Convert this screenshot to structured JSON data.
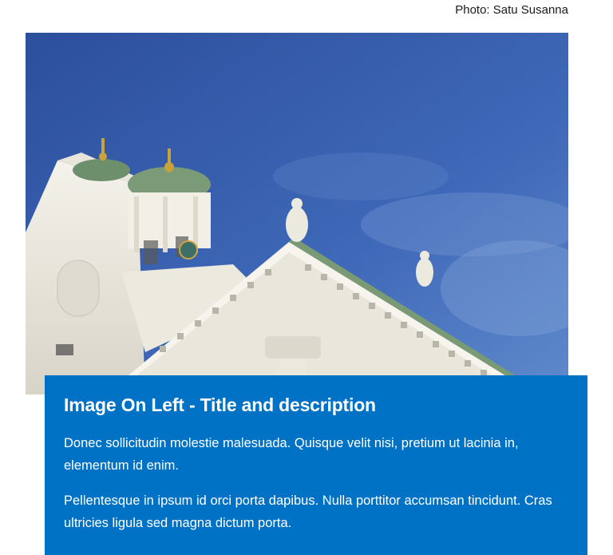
{
  "photo": {
    "credit": "Photo: Satu Susanna",
    "subject_icon": "cathedral-photo"
  },
  "card": {
    "title": "Image On Left - Title and description",
    "paragraphs": [
      "Donec sollicitudin molestie malesuada. Quisque velit nisi, pretium ut lacinia in, elementum id enim.",
      "Pellentesque in ipsum id orci porta dapibus. Nulla porttitor accumsan tincidunt. Cras ultricies ligula sed magna dictum porta."
    ],
    "background": "#0072c6"
  }
}
